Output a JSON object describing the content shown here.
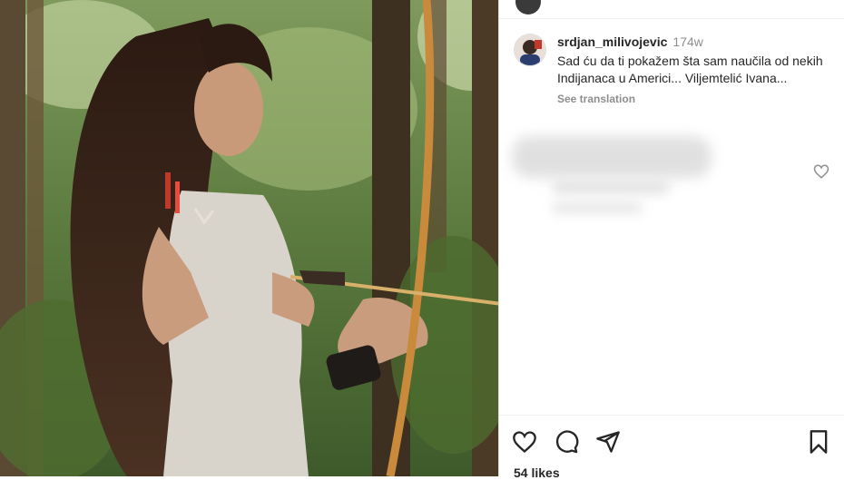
{
  "post": {
    "username": "srdjan_milivojevic",
    "time_ago": "174w",
    "caption": "Sad ću da ti pokažem šta sam naučila od nekih Indijanaca u Americi... Viljemtelić Ivana...",
    "see_translation": "See translation",
    "likes": "54 likes"
  },
  "icons": {
    "like": "heart-icon",
    "comment": "comment-icon",
    "share": "share-icon",
    "save": "bookmark-icon",
    "comment_like": "heart-icon"
  },
  "colors": {
    "text": "#262626",
    "muted": "#8e8e8e",
    "divider": "#dbdbdb"
  }
}
